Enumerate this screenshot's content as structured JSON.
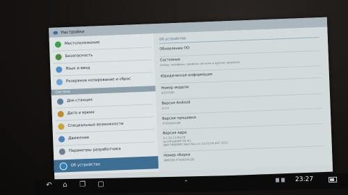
{
  "titlebar": {
    "title": "Настройки"
  },
  "sidebar": {
    "items_top": [
      {
        "label": "Местоположение",
        "icon": "location-icon",
        "color": "#3aa34a"
      },
      {
        "label": "Безопасность",
        "icon": "security-icon",
        "color": "#4c8b3e"
      },
      {
        "label": "Язык и ввод",
        "icon": "language-icon",
        "color": "#4f8fc6"
      },
      {
        "label": "Резервное копирование и сброс",
        "icon": "backup-icon",
        "color": "#6aa3d8"
      }
    ],
    "section_label": "Система",
    "items_bottom": [
      {
        "label": "Док-станция",
        "icon": "dock-icon",
        "color": "#5f7f9b"
      },
      {
        "label": "Дата и время",
        "icon": "clock-icon",
        "color": "#c28a2f"
      },
      {
        "label": "Специальные возможности",
        "icon": "accessibility-icon",
        "color": "#c9a23a"
      },
      {
        "label": "Движение",
        "icon": "motion-icon",
        "color": "#4d84b9"
      },
      {
        "label": "Параметры разработчика",
        "icon": "developer-icon",
        "color": "#6c7f8e"
      },
      {
        "label": "Об устройстве",
        "icon": "info-icon",
        "color": "#2f7fc1",
        "selected": true
      }
    ]
  },
  "detail": {
    "header": "Об устройстве",
    "items": [
      {
        "title": "Обновление ПО",
        "sub": ""
      },
      {
        "title": "Состояние",
        "sub": "Номер телефона, уровень сигнала и другие сведения"
      },
      {
        "title": "Юридическая информация",
        "sub": ""
      },
      {
        "title": "Номер модели",
        "sub": "GT-P7500"
      },
      {
        "title": "Версия Android",
        "sub": "4.0.4"
      },
      {
        "title": "Версия прошивки",
        "sub": "P7500XXLQ8"
      },
      {
        "title": "Версия ядра",
        "sub": "3.1.10-1178276\nse.infra@SEP-54 #1\nSMP PREEMPT Wed Nov 21 19:55:04 KST 2012"
      },
      {
        "title": "Номер сборки",
        "sub": "IMM76D.P7500XXLQ8"
      }
    ]
  },
  "statusbar": {
    "time": "23:27"
  },
  "colors": {
    "accent": "#3e6f93",
    "screen_bg": "#cfd6d8"
  }
}
